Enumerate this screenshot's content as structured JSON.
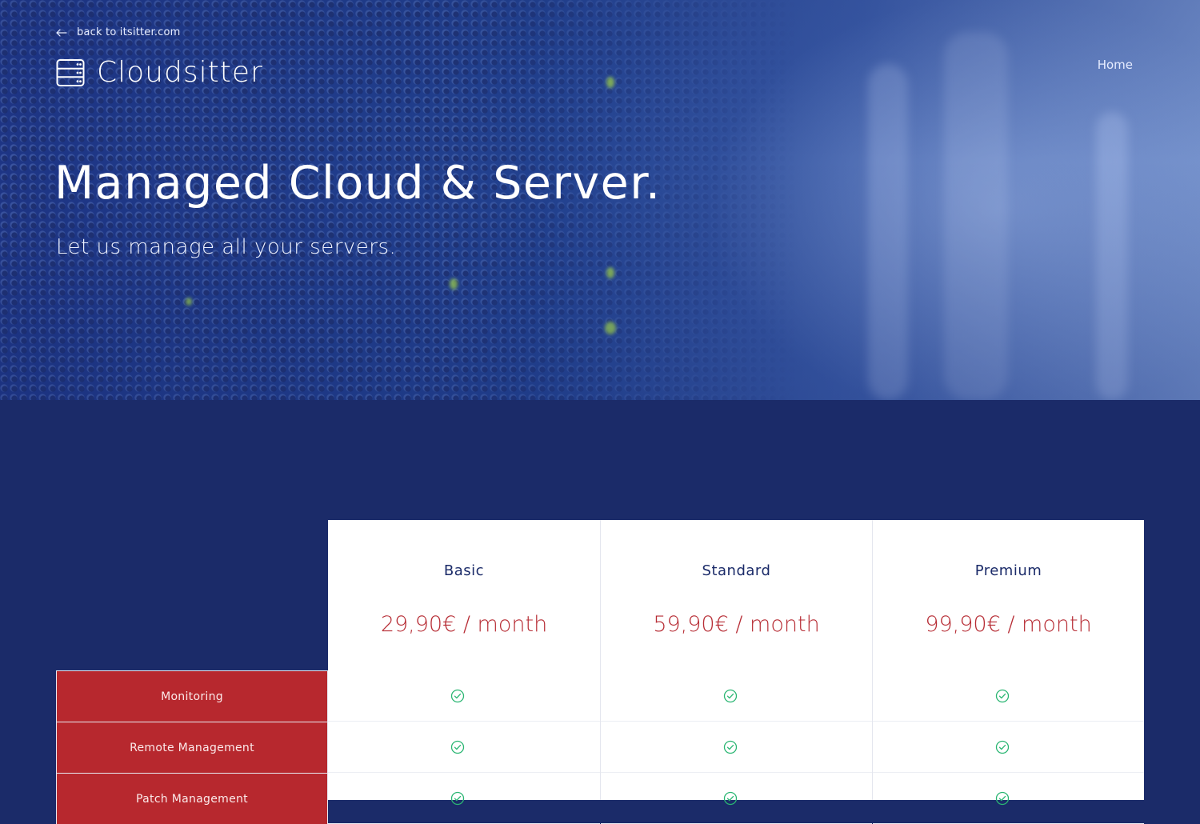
{
  "header": {
    "back_link": "back to itsitter.com",
    "brand_name": "Cloudsitter",
    "nav": [
      {
        "label": "Home"
      }
    ]
  },
  "hero": {
    "headline": "Managed Cloud & Server.",
    "subheadline": "Let us manage all your servers."
  },
  "pricing": {
    "plans": [
      {
        "name": "Basic",
        "price": "29,90€ / month"
      },
      {
        "name": "Standard",
        "price": "59,90€ / month"
      },
      {
        "name": "Premium",
        "price": "99,90€ / month"
      }
    ],
    "features": [
      {
        "label": "Monitoring",
        "included": [
          true,
          true,
          true
        ]
      },
      {
        "label": "Remote Management",
        "included": [
          true,
          true,
          true
        ]
      },
      {
        "label": "Patch Management",
        "included": [
          true,
          true,
          true
        ]
      }
    ]
  },
  "colors": {
    "background": "#1b2b69",
    "accent_red": "#b7282e",
    "price_red": "#b72d35",
    "check_green": "#2bb673"
  },
  "icons": {
    "back": "arrow-left-icon",
    "brand": "server-icon",
    "included": "check-circle-icon"
  }
}
